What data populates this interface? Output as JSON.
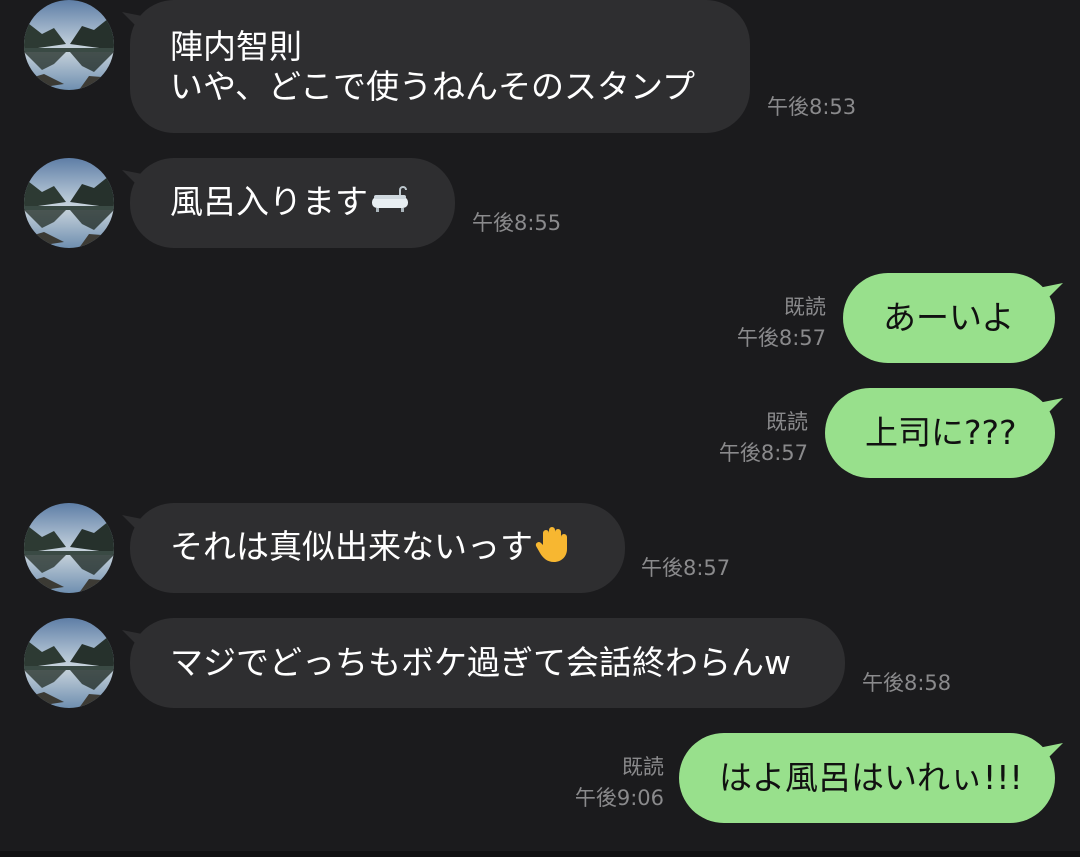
{
  "messages": [
    {
      "direction": "in",
      "sender": "陣内智則",
      "text": "いや、どこで使うねんそのスタンプ",
      "time": "午後8:53"
    },
    {
      "direction": "in",
      "text": "風呂入ります",
      "emoji": "bathtub-icon",
      "time": "午後8:55"
    },
    {
      "direction": "out",
      "read": "既読",
      "text": "あーいよ",
      "time": "午後8:57"
    },
    {
      "direction": "out",
      "read": "既読",
      "text": "上司に???",
      "time": "午後8:57"
    },
    {
      "direction": "in",
      "text": "それは真似出来ないっす",
      "emoji": "raised-hand-icon",
      "time": "午後8:57"
    },
    {
      "direction": "in",
      "text": "マジでどっちもボケ過ぎて会話終わらんw",
      "time": "午後8:58"
    },
    {
      "direction": "out",
      "read": "既読",
      "text": "はよ風呂はいれぃ!!!",
      "time": "午後9:06"
    }
  ],
  "colors": {
    "background": "#1b1b1d",
    "incoming_bubble": "#2e2e30",
    "outgoing_bubble": "#98e08c",
    "meta_text": "#8a8a8c"
  }
}
